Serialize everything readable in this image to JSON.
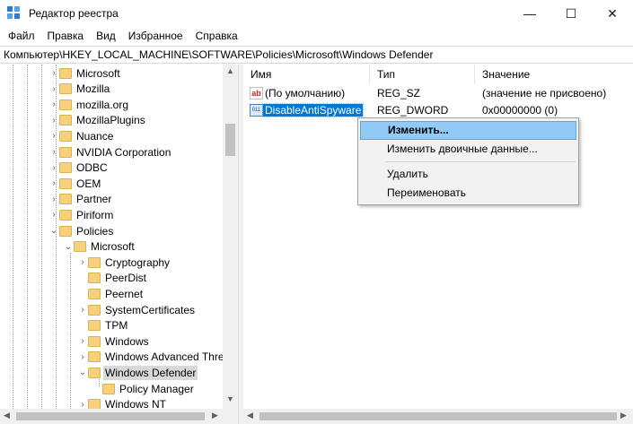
{
  "window": {
    "title": "Редактор реестра",
    "app_icon": "regedit-icon",
    "minimize_glyph": "—",
    "maximize_glyph": "☐",
    "close_glyph": "✕"
  },
  "menu": [
    "Файл",
    "Правка",
    "Вид",
    "Избранное",
    "Справка"
  ],
  "address": "Компьютер\\HKEY_LOCAL_MACHINE\\SOFTWARE\\Policies\\Microsoft\\Windows Defender",
  "tree": {
    "items": [
      {
        "label": "Microsoft",
        "level": 0,
        "expander": "›"
      },
      {
        "label": "Mozilla",
        "level": 0,
        "expander": "›"
      },
      {
        "label": "mozilla.org",
        "level": 0,
        "expander": "›"
      },
      {
        "label": "MozillaPlugins",
        "level": 0,
        "expander": "›"
      },
      {
        "label": "Nuance",
        "level": 0,
        "expander": "›"
      },
      {
        "label": "NVIDIA Corporation",
        "level": 0,
        "expander": "›"
      },
      {
        "label": "ODBC",
        "level": 0,
        "expander": "›"
      },
      {
        "label": "OEM",
        "level": 0,
        "expander": "›"
      },
      {
        "label": "Partner",
        "level": 0,
        "expander": "›"
      },
      {
        "label": "Piriform",
        "level": 0,
        "expander": "›"
      },
      {
        "label": "Policies",
        "level": 0,
        "expander": "⌄"
      },
      {
        "label": "Microsoft",
        "level": 1,
        "expander": "⌄"
      },
      {
        "label": "Cryptography",
        "level": 2,
        "expander": "›"
      },
      {
        "label": "PeerDist",
        "level": 2,
        "expander": ""
      },
      {
        "label": "Peernet",
        "level": 2,
        "expander": ""
      },
      {
        "label": "SystemCertificates",
        "level": 2,
        "expander": "›"
      },
      {
        "label": "TPM",
        "level": 2,
        "expander": ""
      },
      {
        "label": "Windows",
        "level": 2,
        "expander": "›"
      },
      {
        "label": "Windows Advanced Threat Protection",
        "level": 2,
        "expander": "›"
      },
      {
        "label": "Windows Defender",
        "level": 2,
        "expander": "⌄",
        "selected": true
      },
      {
        "label": "Policy Manager",
        "level": 3,
        "expander": ""
      },
      {
        "label": "Windows NT",
        "level": 2,
        "expander": "›"
      }
    ]
  },
  "columns": {
    "name": "Имя",
    "type": "Тип",
    "value": "Значение"
  },
  "values": [
    {
      "icon": "string-value-icon",
      "icon_text": "ab",
      "name": "(По умолчанию)",
      "type": "REG_SZ",
      "data": "(значение не присвоено)"
    },
    {
      "icon": "dword-value-icon",
      "icon_text": "011",
      "name": "DisableAntiSpyware",
      "type": "REG_DWORD",
      "data": "0x00000000 (0)",
      "selected": true
    }
  ],
  "context_menu": {
    "modify": "Изменить...",
    "modify_binary": "Изменить двоичные данные...",
    "delete": "Удалить",
    "rename": "Переименовать"
  },
  "colors": {
    "selection": "#0078d7",
    "menu_highlight": "#91c9f7",
    "folder": "#f5d27a"
  }
}
